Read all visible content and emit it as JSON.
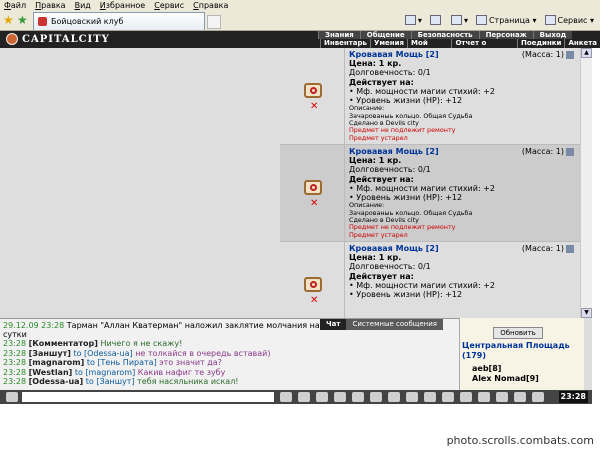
{
  "browser": {
    "menu": [
      "Файл",
      "Правка",
      "Вид",
      "Избранное",
      "Сервис",
      "Справка"
    ],
    "tab_title": "Бойцовский клуб",
    "tools": {
      "page_label": "Страница",
      "service_label": "Сервис"
    }
  },
  "game": {
    "logo": "CAPITALCITY",
    "nav_top": [
      "Знания",
      "Общение",
      "Безопасность",
      "Персонаж",
      "Выход"
    ],
    "nav_bottom": [
      "Инвентарь",
      "Умения",
      "Мой Скролл",
      "Отчет о переводах",
      "Поединки",
      "Анкета"
    ]
  },
  "items": [
    {
      "name": "Кровавая Мощь [2]",
      "mass": "(Масса: 1)",
      "price": "Цена: 1 кр.",
      "durability": "Долговечность: 0/1",
      "effects_title": "Действует на:",
      "effects": [
        "• Мф. мощности магии стихий: +2",
        "• Уровень жизни (HP): +12"
      ],
      "desc_title": "Описание:",
      "desc": "Зачарованыь кольцо. Общая Судьба",
      "made": "Сделано в Devils city",
      "warn1": "Предмет не подлежит ремонту",
      "warn2": "Предмет устарел"
    },
    {
      "name": "Кровавая Мощь [2]",
      "mass": "(Масса: 1)",
      "price": "Цена: 1 кр.",
      "durability": "Долговечность: 0/1",
      "effects_title": "Действует на:",
      "effects": [
        "• Мф. мощности магии стихий: +2",
        "• Уровень жизни (HP): +12"
      ],
      "desc_title": "Описание:",
      "desc": "Зачарованыь кольцо. Общая Судьба",
      "made": "Сделано в Devils city",
      "warn1": "Предмет не подлежит ремонту",
      "warn2": "Предмет устарел"
    },
    {
      "name": "Кровавая Мощь [2]",
      "mass": "(Масса: 1)",
      "price": "Цена: 1 кр.",
      "durability": "Долговечность: 0/1",
      "effects_title": "Действует на:",
      "effects": [
        "• Мф. мощности магии стихий: +2",
        "• Уровень жизни (HP): +12"
      ]
    }
  ],
  "chat": {
    "tabs": [
      "Чат",
      "Системные сообщения"
    ],
    "system": {
      "time": "29.12.09 23:28",
      "text": "Тарман \"Аллан Кватерман\" наложил заклятие молчания на",
      "tail": "сутки"
    },
    "lines": [
      {
        "time": "23:28",
        "nick": "[Комментатор]",
        "to": "",
        "msg": "Ничего я не скажу!"
      },
      {
        "time": "23:28",
        "nick": "[Заншут]",
        "to": "to [Odessa-ua]",
        "msg": "не толкайся в очередь вставай)"
      },
      {
        "time": "23:28",
        "nick": "[magnarom]",
        "to": "to [Тень Пирата]",
        "msg": "это значит да?"
      },
      {
        "time": "23:28",
        "nick": "[Westlan]",
        "to": "to [magnarom]",
        "msg": "Какив нафиг те зубу"
      },
      {
        "time": "23:28",
        "nick": "[Odessa-ua]",
        "to": "to [Заншут]",
        "msg": "тебя насяльника искал!"
      }
    ]
  },
  "room": {
    "refresh": "Обновить",
    "title": "Центральная Площадь",
    "count": "(179)",
    "users": [
      "aeb[8]",
      "Alex Nomad[9]"
    ]
  },
  "clock": "23:28",
  "watermark": "photo.scrolls.combats.com"
}
